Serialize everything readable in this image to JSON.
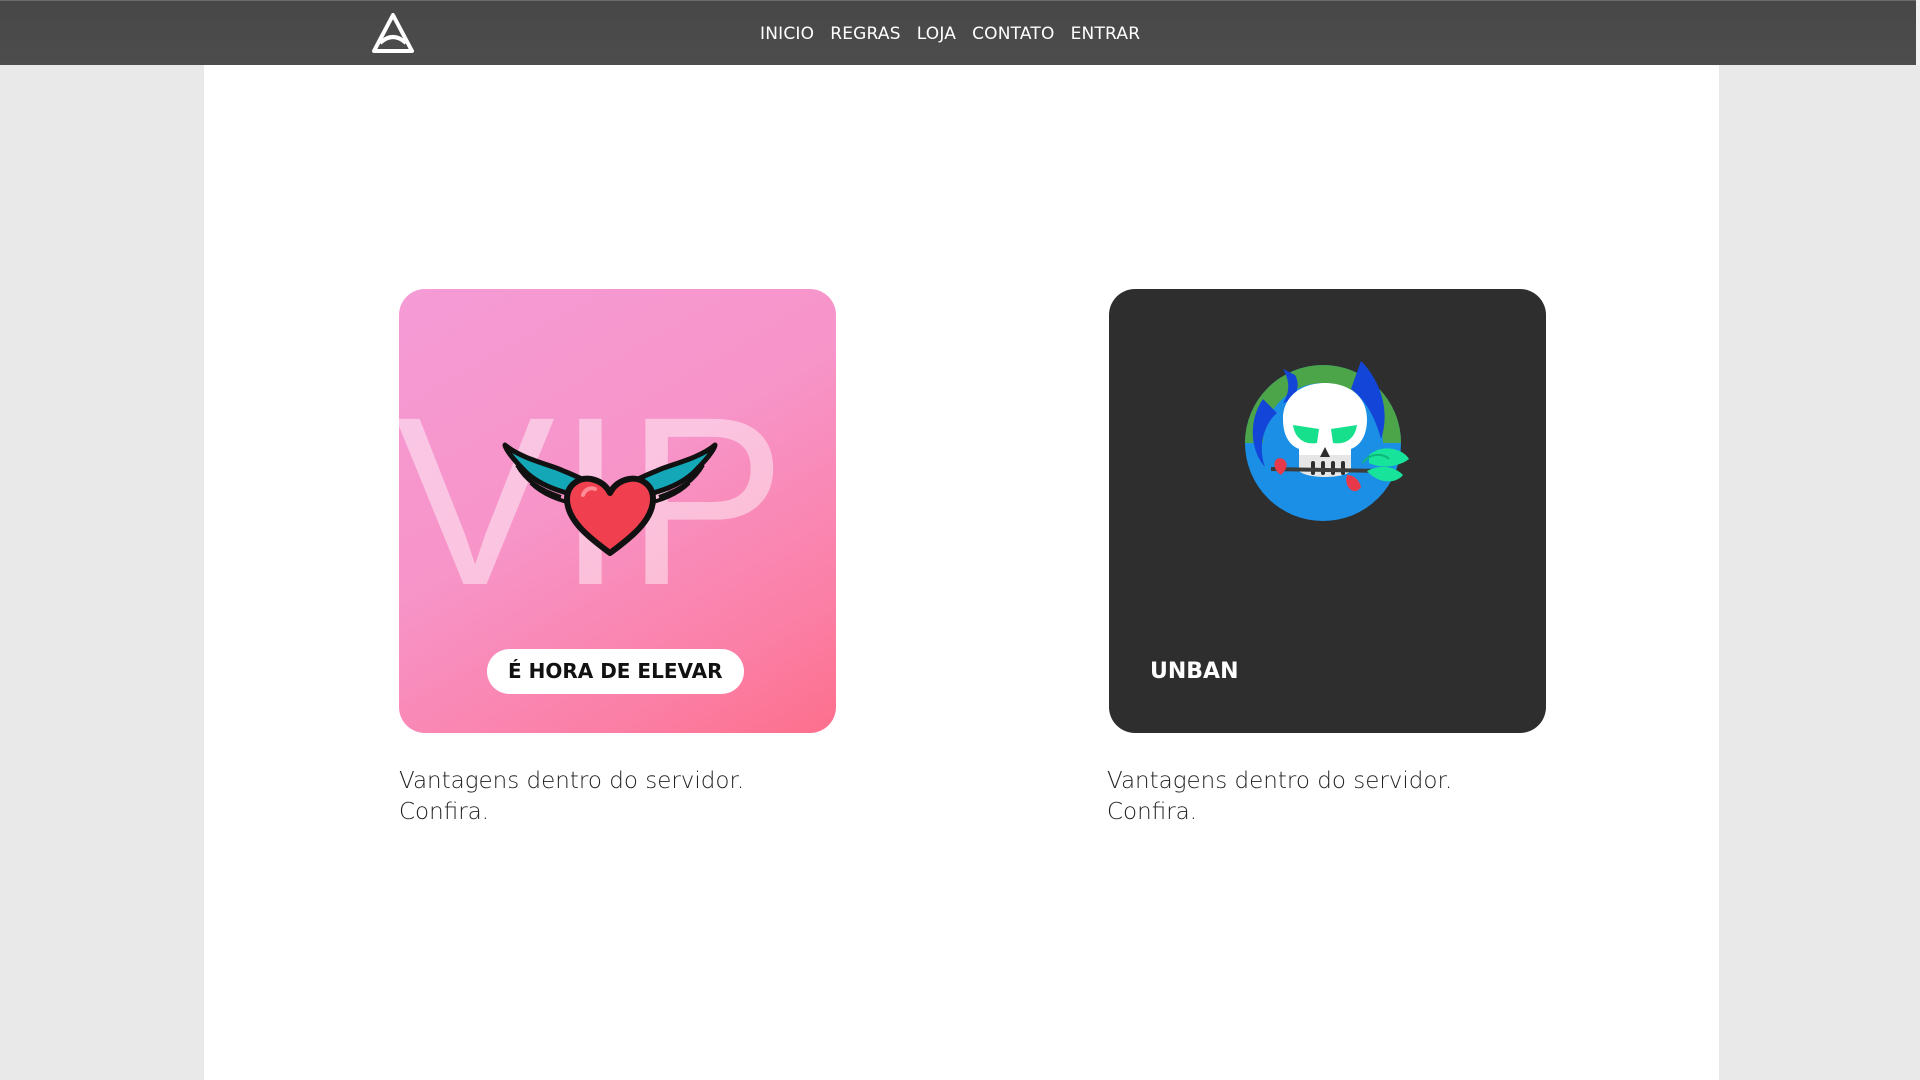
{
  "nav": {
    "logo": "site-logo",
    "links": [
      "INICIO",
      "REGRAS",
      "LOJA",
      "CONTATO",
      "ENTRAR"
    ]
  },
  "cards": {
    "vip": {
      "watermark": "VIP",
      "button_label": "É HORA DE ELEVAR",
      "icon": "winged-heart-icon",
      "description_line1": "Vantagens dentro do servidor.",
      "description_line2": "Confira."
    },
    "unban": {
      "label": "UNBAN",
      "icon": "skull-rose-icon",
      "description_line1": "Vantagens dentro do servidor.",
      "description_line2": "Confira."
    }
  },
  "colors": {
    "navbar": "#4a4a4a",
    "vip_gradient_start": "#f59bd6",
    "vip_gradient_end": "#fd6f8c",
    "unban_bg": "#2e2e2e",
    "page_bg": "#e9e9e9"
  }
}
